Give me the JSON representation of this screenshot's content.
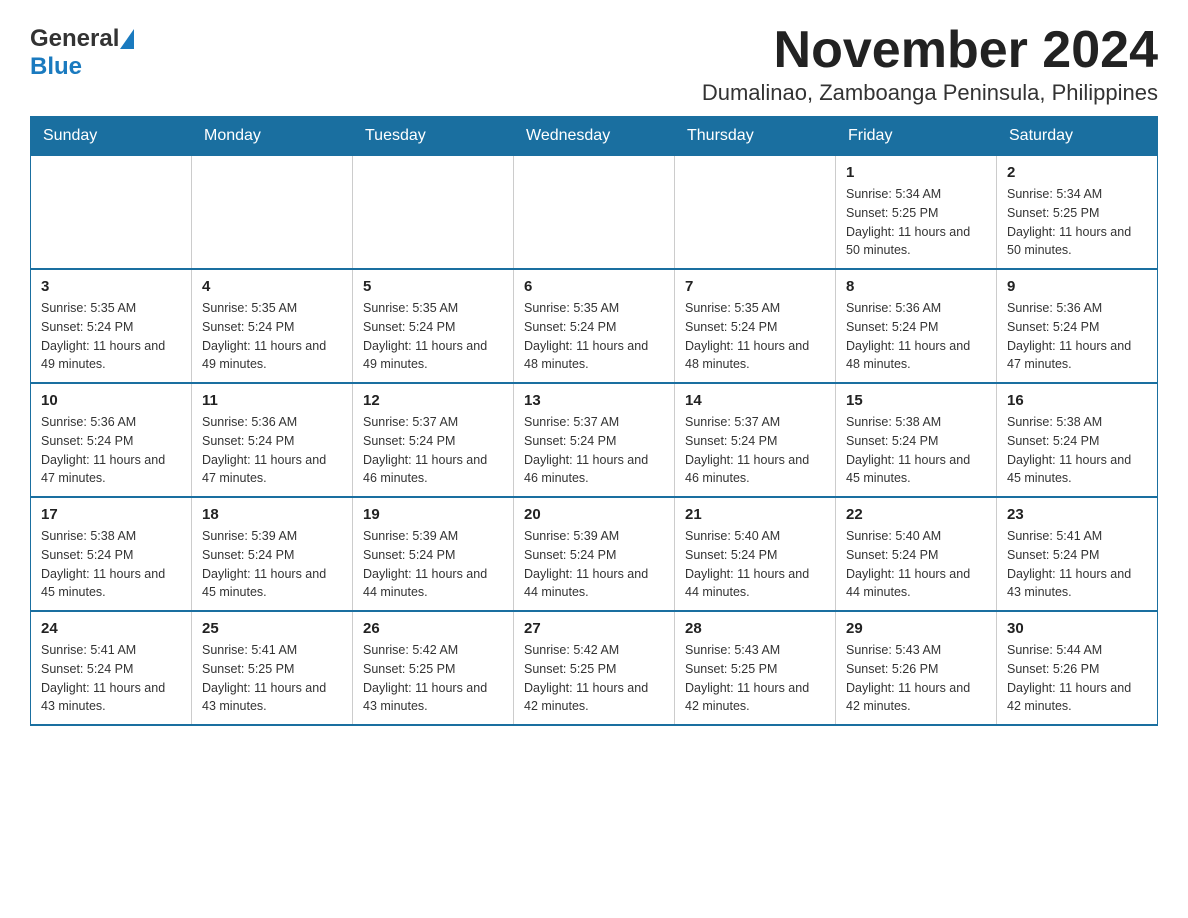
{
  "header": {
    "logo_general": "General",
    "logo_blue": "Blue",
    "title": "November 2024",
    "subtitle": "Dumalinao, Zamboanga Peninsula, Philippines"
  },
  "calendar": {
    "days_of_week": [
      "Sunday",
      "Monday",
      "Tuesday",
      "Wednesday",
      "Thursday",
      "Friday",
      "Saturday"
    ],
    "weeks": [
      {
        "days": [
          {
            "day": "",
            "info": ""
          },
          {
            "day": "",
            "info": ""
          },
          {
            "day": "",
            "info": ""
          },
          {
            "day": "",
            "info": ""
          },
          {
            "day": "",
            "info": ""
          },
          {
            "day": "1",
            "info": "Sunrise: 5:34 AM\nSunset: 5:25 PM\nDaylight: 11 hours and 50 minutes."
          },
          {
            "day": "2",
            "info": "Sunrise: 5:34 AM\nSunset: 5:25 PM\nDaylight: 11 hours and 50 minutes."
          }
        ]
      },
      {
        "days": [
          {
            "day": "3",
            "info": "Sunrise: 5:35 AM\nSunset: 5:24 PM\nDaylight: 11 hours and 49 minutes."
          },
          {
            "day": "4",
            "info": "Sunrise: 5:35 AM\nSunset: 5:24 PM\nDaylight: 11 hours and 49 minutes."
          },
          {
            "day": "5",
            "info": "Sunrise: 5:35 AM\nSunset: 5:24 PM\nDaylight: 11 hours and 49 minutes."
          },
          {
            "day": "6",
            "info": "Sunrise: 5:35 AM\nSunset: 5:24 PM\nDaylight: 11 hours and 48 minutes."
          },
          {
            "day": "7",
            "info": "Sunrise: 5:35 AM\nSunset: 5:24 PM\nDaylight: 11 hours and 48 minutes."
          },
          {
            "day": "8",
            "info": "Sunrise: 5:36 AM\nSunset: 5:24 PM\nDaylight: 11 hours and 48 minutes."
          },
          {
            "day": "9",
            "info": "Sunrise: 5:36 AM\nSunset: 5:24 PM\nDaylight: 11 hours and 47 minutes."
          }
        ]
      },
      {
        "days": [
          {
            "day": "10",
            "info": "Sunrise: 5:36 AM\nSunset: 5:24 PM\nDaylight: 11 hours and 47 minutes."
          },
          {
            "day": "11",
            "info": "Sunrise: 5:36 AM\nSunset: 5:24 PM\nDaylight: 11 hours and 47 minutes."
          },
          {
            "day": "12",
            "info": "Sunrise: 5:37 AM\nSunset: 5:24 PM\nDaylight: 11 hours and 46 minutes."
          },
          {
            "day": "13",
            "info": "Sunrise: 5:37 AM\nSunset: 5:24 PM\nDaylight: 11 hours and 46 minutes."
          },
          {
            "day": "14",
            "info": "Sunrise: 5:37 AM\nSunset: 5:24 PM\nDaylight: 11 hours and 46 minutes."
          },
          {
            "day": "15",
            "info": "Sunrise: 5:38 AM\nSunset: 5:24 PM\nDaylight: 11 hours and 45 minutes."
          },
          {
            "day": "16",
            "info": "Sunrise: 5:38 AM\nSunset: 5:24 PM\nDaylight: 11 hours and 45 minutes."
          }
        ]
      },
      {
        "days": [
          {
            "day": "17",
            "info": "Sunrise: 5:38 AM\nSunset: 5:24 PM\nDaylight: 11 hours and 45 minutes."
          },
          {
            "day": "18",
            "info": "Sunrise: 5:39 AM\nSunset: 5:24 PM\nDaylight: 11 hours and 45 minutes."
          },
          {
            "day": "19",
            "info": "Sunrise: 5:39 AM\nSunset: 5:24 PM\nDaylight: 11 hours and 44 minutes."
          },
          {
            "day": "20",
            "info": "Sunrise: 5:39 AM\nSunset: 5:24 PM\nDaylight: 11 hours and 44 minutes."
          },
          {
            "day": "21",
            "info": "Sunrise: 5:40 AM\nSunset: 5:24 PM\nDaylight: 11 hours and 44 minutes."
          },
          {
            "day": "22",
            "info": "Sunrise: 5:40 AM\nSunset: 5:24 PM\nDaylight: 11 hours and 44 minutes."
          },
          {
            "day": "23",
            "info": "Sunrise: 5:41 AM\nSunset: 5:24 PM\nDaylight: 11 hours and 43 minutes."
          }
        ]
      },
      {
        "days": [
          {
            "day": "24",
            "info": "Sunrise: 5:41 AM\nSunset: 5:24 PM\nDaylight: 11 hours and 43 minutes."
          },
          {
            "day": "25",
            "info": "Sunrise: 5:41 AM\nSunset: 5:25 PM\nDaylight: 11 hours and 43 minutes."
          },
          {
            "day": "26",
            "info": "Sunrise: 5:42 AM\nSunset: 5:25 PM\nDaylight: 11 hours and 43 minutes."
          },
          {
            "day": "27",
            "info": "Sunrise: 5:42 AM\nSunset: 5:25 PM\nDaylight: 11 hours and 42 minutes."
          },
          {
            "day": "28",
            "info": "Sunrise: 5:43 AM\nSunset: 5:25 PM\nDaylight: 11 hours and 42 minutes."
          },
          {
            "day": "29",
            "info": "Sunrise: 5:43 AM\nSunset: 5:26 PM\nDaylight: 11 hours and 42 minutes."
          },
          {
            "day": "30",
            "info": "Sunrise: 5:44 AM\nSunset: 5:26 PM\nDaylight: 11 hours and 42 minutes."
          }
        ]
      }
    ]
  }
}
